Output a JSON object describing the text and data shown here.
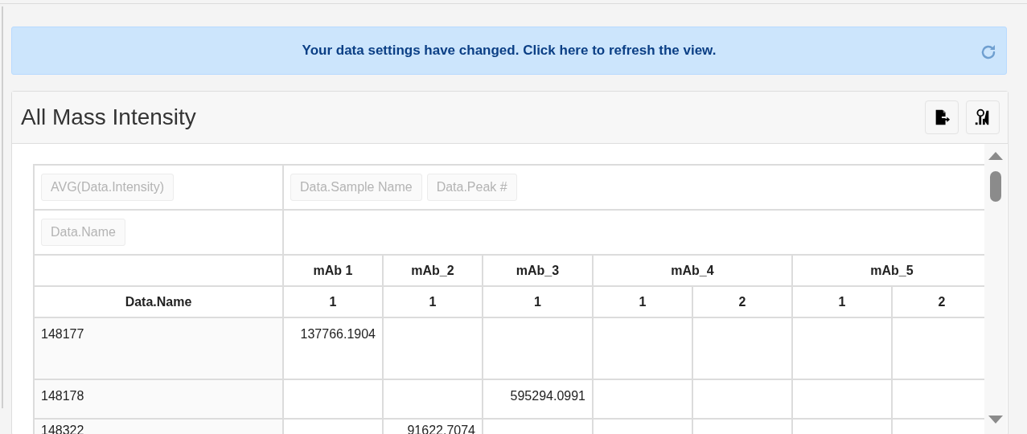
{
  "banner": {
    "text": "Your data settings have changed. Click here to refresh the view."
  },
  "panel": {
    "title": "All Mass Intensity"
  },
  "pivot": {
    "value_fields": [
      "AVG(Data.Intensity)"
    ],
    "column_fields": [
      "Data.Sample Name",
      "Data.Peak #"
    ],
    "row_fields": [
      "Data.Name"
    ],
    "row_header": "Data.Name",
    "column_groups": [
      {
        "label": "mAb 1",
        "subs": [
          "1"
        ]
      },
      {
        "label": "mAb_2",
        "subs": [
          "1"
        ]
      },
      {
        "label": "mAb_3",
        "subs": [
          "1"
        ]
      },
      {
        "label": "mAb_4",
        "subs": [
          "1",
          "2"
        ]
      },
      {
        "label": "mAb_5",
        "subs": [
          "1",
          "2"
        ]
      }
    ],
    "rows": [
      {
        "name": "148177",
        "cells": [
          "137766.1904",
          null,
          null,
          null,
          null,
          null,
          null
        ]
      },
      {
        "name": "148178",
        "cells": [
          null,
          null,
          "595294.0991",
          null,
          null,
          null,
          null
        ]
      },
      {
        "name": "148322",
        "cells": [
          null,
          "91622.7074",
          null,
          null,
          null,
          null,
          null
        ]
      }
    ]
  }
}
